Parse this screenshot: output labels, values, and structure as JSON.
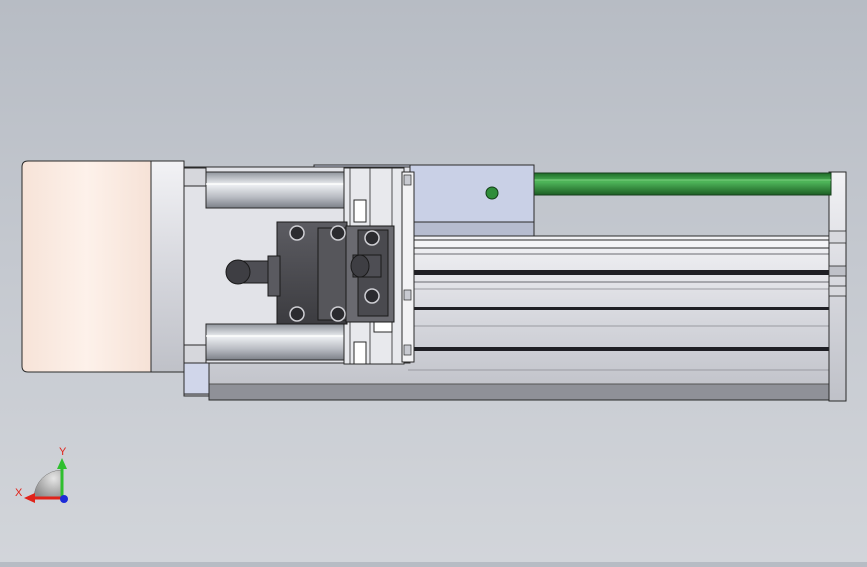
{
  "viewport": {
    "background_top": "#b7bcc4",
    "background_bottom": "#d2d5da"
  },
  "model": {
    "name": "linear-actuator-module",
    "colors": {
      "motor_housing": "#fbece3",
      "metal_light": "#e0e1e6",
      "metal_mid": "#c9cbd3",
      "metal_dark": "#8f9198",
      "carriage_block": "#d0d6ea",
      "slider_block": "#4b4b4f",
      "guide_rod": "#2f8d3a",
      "edge_line": "#2a2a2a"
    }
  },
  "triad": {
    "x_label": "X",
    "y_label": "Y",
    "x_color": "#e0231a",
    "y_color": "#2fbf2f",
    "z_color": "#1c2bd8",
    "label_color": "#e0231a"
  }
}
